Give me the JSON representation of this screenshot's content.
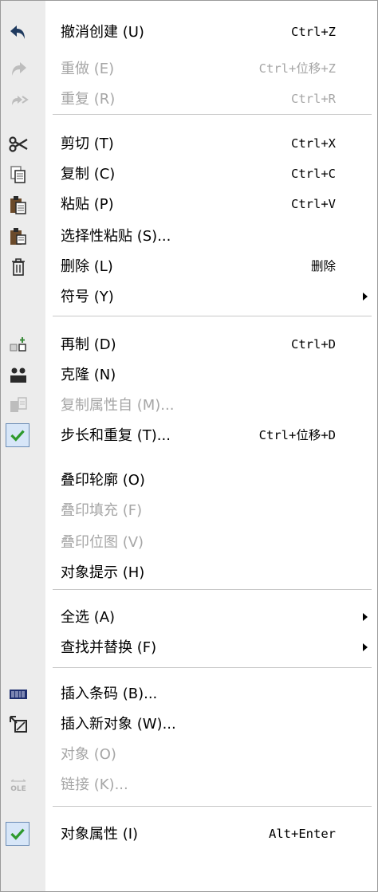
{
  "menu": {
    "items": [
      {
        "label": "撤消创建 (U)",
        "shortcut": "Ctrl+Z",
        "icon": "undo-icon"
      },
      {
        "label": "重做 (E)",
        "shortcut": "Ctrl+位移+Z",
        "icon": "redo-icon",
        "disabled": true
      },
      {
        "label": "重复 (R)",
        "shortcut": "Ctrl+R",
        "icon": "repeat-icon",
        "disabled": true
      },
      {
        "label": "剪切 (T)",
        "shortcut": "Ctrl+X",
        "icon": "scissors-icon"
      },
      {
        "label": "复制 (C)",
        "shortcut": "Ctrl+C",
        "icon": "copy-icon"
      },
      {
        "label": "粘贴 (P)",
        "shortcut": "Ctrl+V",
        "icon": "paste-icon"
      },
      {
        "label": "选择性粘贴 (S)...",
        "shortcut": "",
        "icon": "paste-special-icon"
      },
      {
        "label": "删除 (L)",
        "shortcut": "删除",
        "icon": "trash-icon"
      },
      {
        "label": "符号 (Y)",
        "shortcut": "",
        "icon": "",
        "submenu": true
      },
      {
        "label": "再制 (D)",
        "shortcut": "Ctrl+D",
        "icon": "duplicate-icon"
      },
      {
        "label": "克隆 (N)",
        "shortcut": "",
        "icon": "clone-icon"
      },
      {
        "label": "复制属性自 (M)...",
        "shortcut": "",
        "icon": "copy-properties-icon",
        "disabled": true
      },
      {
        "label": "步长和重复 (T)...",
        "shortcut": "Ctrl+位移+D",
        "icon": "checkmark-icon",
        "checked": true
      },
      {
        "label": "叠印轮廓 (O)",
        "shortcut": "",
        "icon": ""
      },
      {
        "label": "叠印填充 (F)",
        "shortcut": "",
        "icon": "",
        "disabled": true
      },
      {
        "label": "叠印位图 (V)",
        "shortcut": "",
        "icon": "",
        "disabled": true
      },
      {
        "label": "对象提示 (H)",
        "shortcut": "",
        "icon": ""
      },
      {
        "label": "全选 (A)",
        "shortcut": "",
        "icon": "",
        "submenu": true
      },
      {
        "label": "查找并替换 (F)",
        "shortcut": "",
        "icon": "",
        "submenu": true
      },
      {
        "label": "插入条码 (B)...",
        "shortcut": "",
        "icon": "barcode-icon"
      },
      {
        "label": "插入新对象 (W)...",
        "shortcut": "",
        "icon": "insert-object-icon"
      },
      {
        "label": "对象 (O)",
        "shortcut": "",
        "icon": "",
        "disabled": true
      },
      {
        "label": "链接 (K)...",
        "shortcut": "",
        "icon": "ole-link-icon",
        "disabled": true
      },
      {
        "label": "对象属性 (I)",
        "shortcut": "Alt+Enter",
        "icon": "checkmark-icon",
        "checked": true
      }
    ],
    "ole_icon_text": "OLE",
    "colors": {
      "gutter": "#ececec",
      "disabled_text": "#a6a6a6",
      "separator": "#c8c8c8",
      "check_bg": "#d7e6f8",
      "check_mark": "#2e9a2e",
      "undo_blue": "#1f3a5f"
    }
  }
}
